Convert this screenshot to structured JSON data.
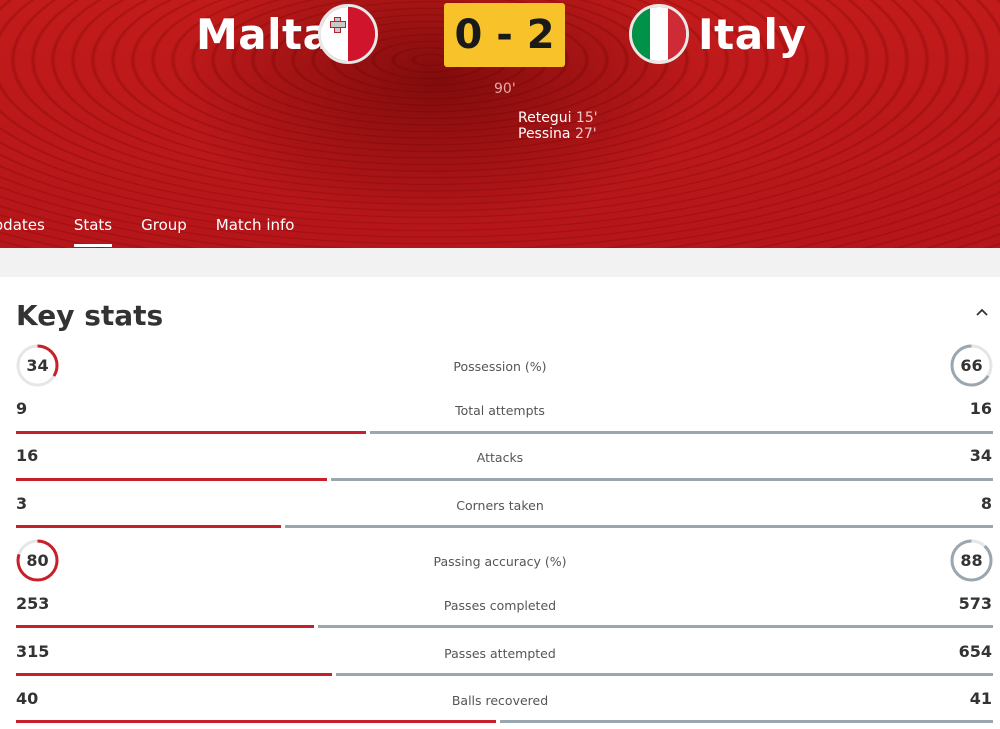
{
  "match": {
    "home_team": "Malta",
    "away_team": "Italy",
    "score": "0 - 2",
    "minute": "90'",
    "scorers": [
      {
        "name": "Retegui",
        "minute": "15'"
      },
      {
        "name": "Pessina",
        "minute": "27'"
      }
    ]
  },
  "tabs": [
    {
      "label": "odates",
      "active": false
    },
    {
      "label": "Stats",
      "active": true
    },
    {
      "label": "Group",
      "active": false
    },
    {
      "label": "Match info",
      "active": false
    }
  ],
  "key_stats": {
    "title": "Key stats",
    "stats": [
      {
        "label": "Possession (%)",
        "home": 34,
        "away": 66,
        "kind": "ring"
      },
      {
        "label": "Total attempts",
        "home": 9,
        "away": 16,
        "kind": "bar"
      },
      {
        "label": "Attacks",
        "home": 16,
        "away": 34,
        "kind": "bar"
      },
      {
        "label": "Corners taken",
        "home": 3,
        "away": 8,
        "kind": "bar"
      },
      {
        "label": "Passing accuracy (%)",
        "home": 80,
        "away": 88,
        "kind": "ring"
      },
      {
        "label": "Passes completed",
        "home": 253,
        "away": 573,
        "kind": "bar"
      },
      {
        "label": "Passes attempted",
        "home": 315,
        "away": 654,
        "kind": "bar"
      },
      {
        "label": "Balls recovered",
        "home": 40,
        "away": 41,
        "kind": "bar"
      }
    ]
  },
  "colors": {
    "home": "#c8202a",
    "away": "#9aa7b0",
    "score_bg": "#f8c22b",
    "header_bg": "#b5161a"
  },
  "icons": {
    "collapse": "chevron-up-icon"
  }
}
